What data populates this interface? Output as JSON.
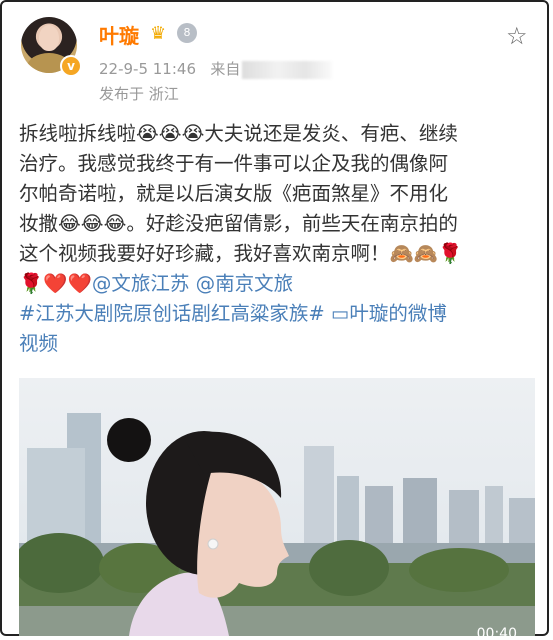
{
  "user": {
    "name": "叶璇",
    "date_time": "22-9-5 11:46",
    "source_prefix": "来自",
    "location_label": "发布于 浙江"
  },
  "post": {
    "lines": [
      "拆线啦拆线啦😭😭😭大夫说还是发炎、有疤、继续",
      "治疗。我感觉我终于有一件事可以企及我的偶像阿",
      "尔帕奇诺啦，就是以后演女版《疤面煞星》不用化",
      "妆撒😂😂😂。好趁没疤留倩影，前些天在南京拍的",
      "这个视频我要好好珍藏，我好喜欢南京啊！🙈🙈🌹"
    ],
    "line6_prefix": "🌹❤️❤️",
    "mention1": "@文旅江苏",
    "mention2": "@南京文旅",
    "topic": "#江苏大剧院原创话剧红高粱家族#",
    "video_link": "叶璇的微博视频",
    "video_link_line1": "叶璇的微博",
    "video_link_line2": "视频"
  },
  "media": {
    "timecode": "00:40"
  },
  "icons": {
    "star": "favorite-star-icon",
    "verified": "verified-badge-icon",
    "video": "video-icon"
  },
  "colors": {
    "username": "#ff7a00",
    "link": "#4a7fb8",
    "meta": "#999999"
  }
}
